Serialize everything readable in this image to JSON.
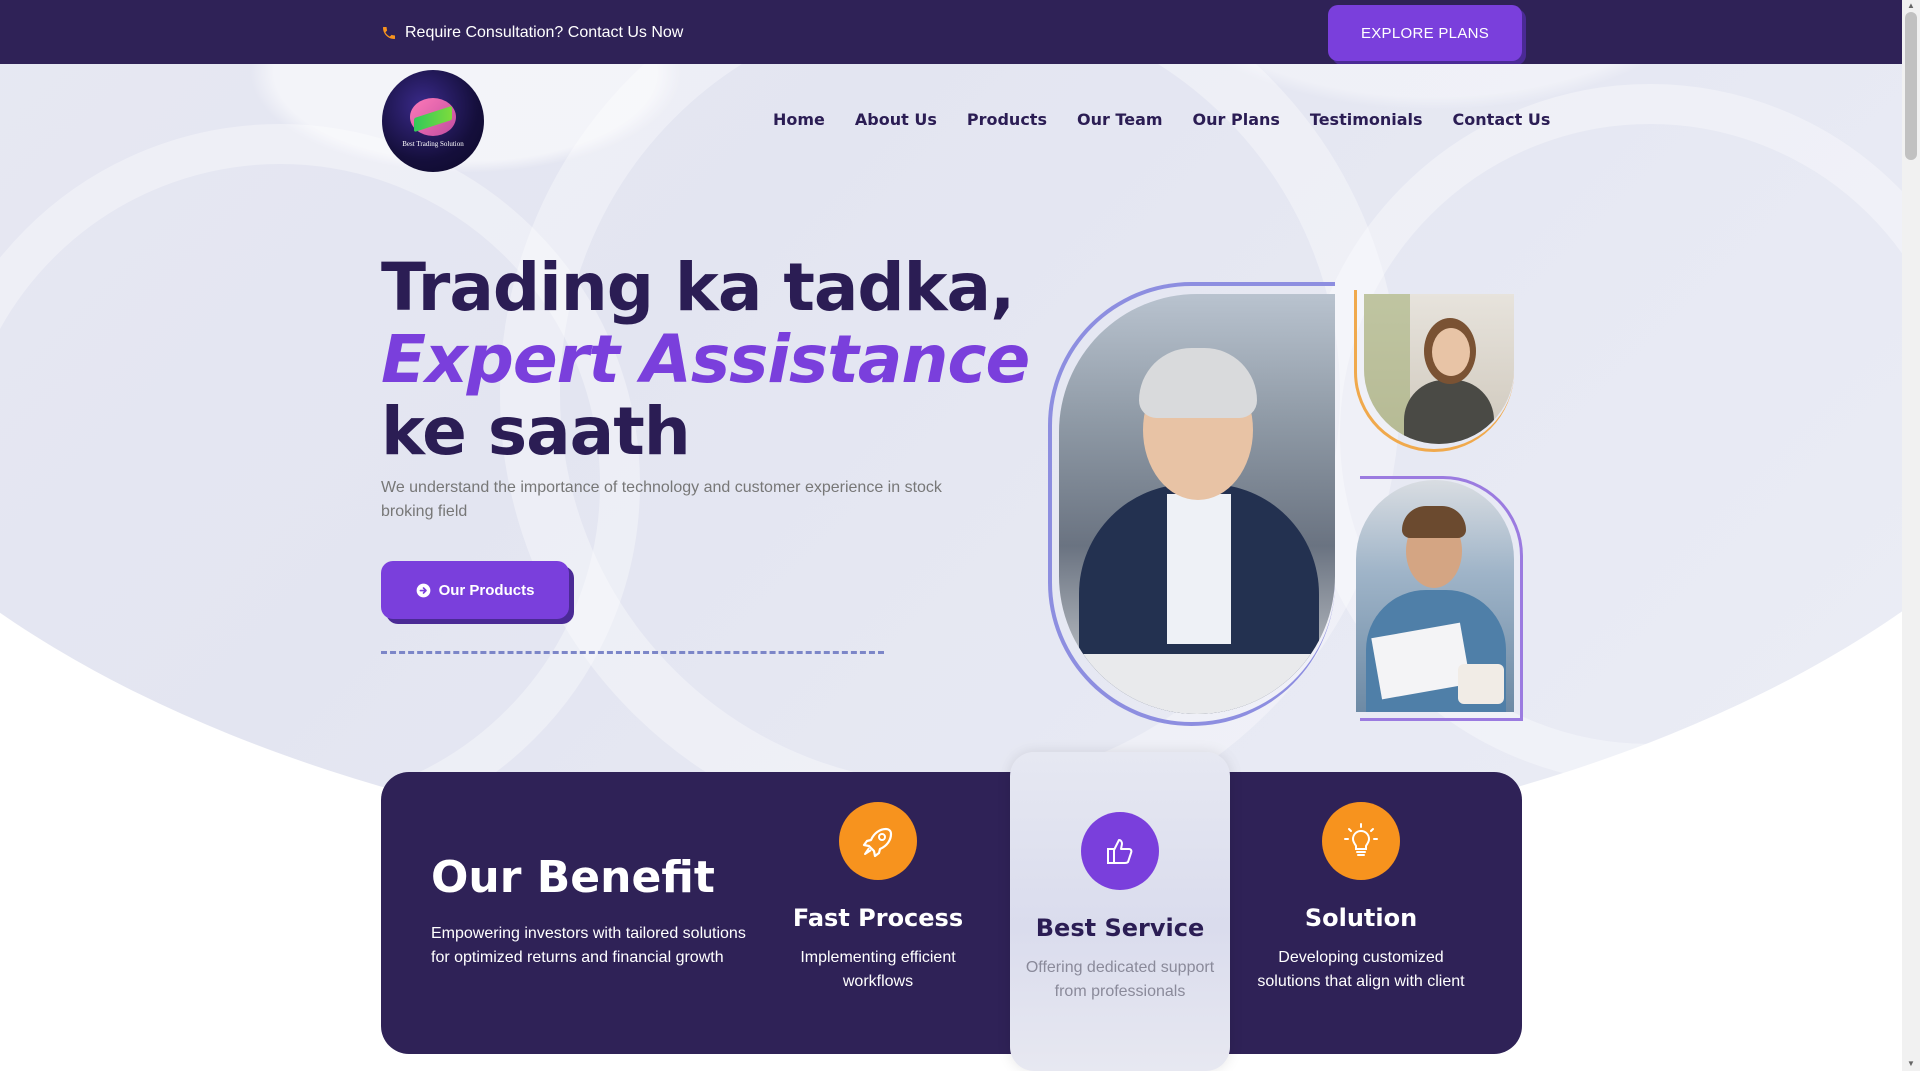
{
  "topbar": {
    "contact_text": "Require Consultation? Contact Us Now",
    "explore_label": "EXPLORE PLANS"
  },
  "logo": {
    "text": "Best Trading Solution"
  },
  "nav": {
    "items": [
      "Home",
      "About Us",
      "Products",
      "Our Team",
      "Our Plans",
      "Testimonials",
      "Contact Us"
    ]
  },
  "hero": {
    "headline_line1": "Trading ka tadka,",
    "headline_accent": "Expert Assistance",
    "headline_line3": "ke saath",
    "subtext": "We understand the importance of technology and customer experience in stock broking field",
    "cta_label": "Our Products"
  },
  "benefit": {
    "title": "Our Benefit",
    "description": "Empowering investors with tailored solutions for optimized returns and financial growth",
    "features": [
      {
        "title": "Fast Process",
        "description": "Implementing efficient workflows",
        "icon": "rocket-icon"
      },
      {
        "title": "Best Service",
        "description": "Offering dedicated support  from  professionals",
        "icon": "thumbs-up-icon"
      },
      {
        "title": "Solution",
        "description": "Developing customized solutions that align with client",
        "icon": "lightbulb-icon"
      }
    ]
  },
  "colors": {
    "primary_dark": "#2f2257",
    "accent_purple": "#7a3fdc",
    "accent_orange": "#f7931e"
  }
}
